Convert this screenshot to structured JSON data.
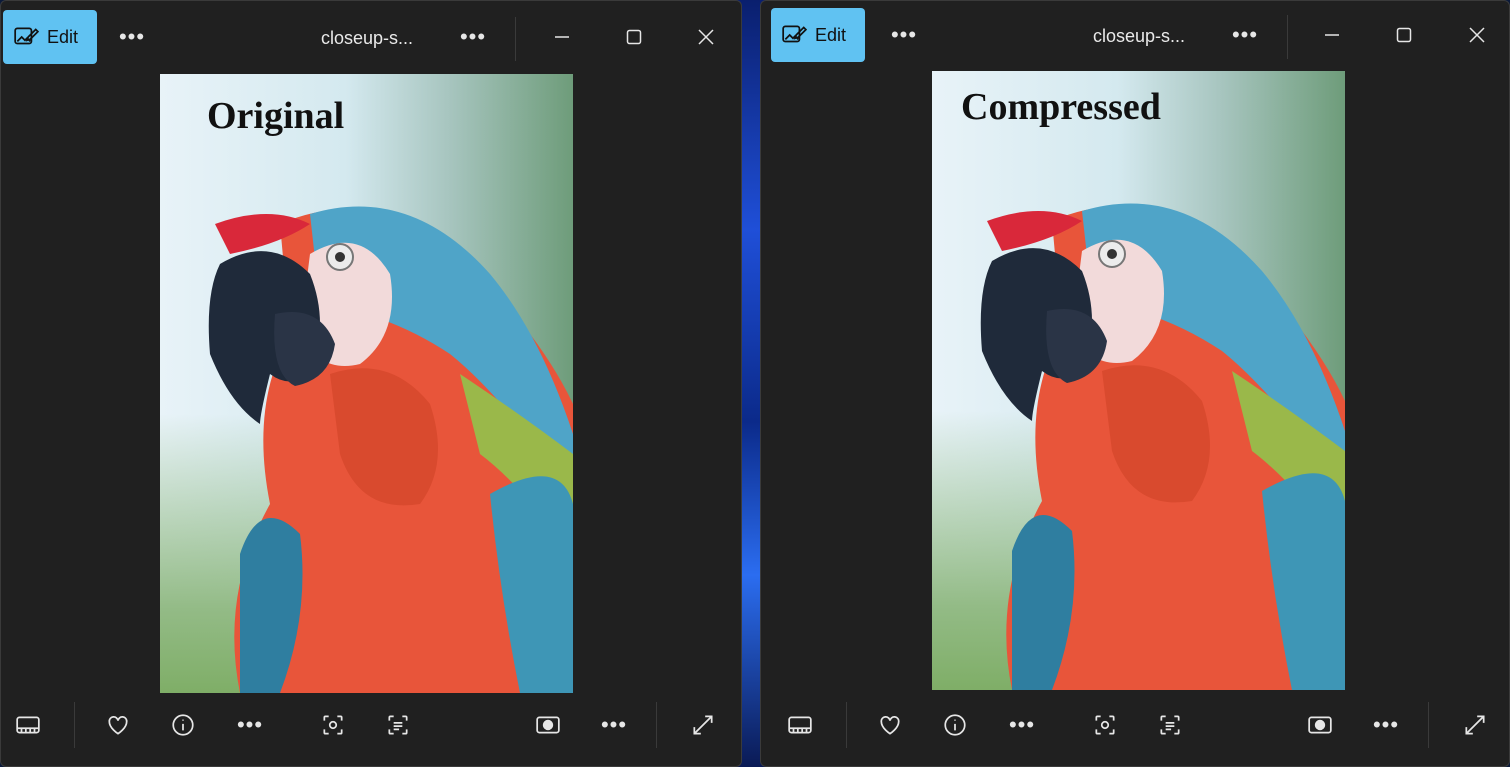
{
  "windows": [
    {
      "id": "left",
      "edit_label": "Edit",
      "file_name": "closeup-s...",
      "image_label": "Original"
    },
    {
      "id": "right",
      "edit_label": "Edit",
      "file_name": "closeup-s...",
      "image_label": "Compressed"
    }
  ],
  "icons": {
    "more": "•••",
    "minimize": "minimize-icon",
    "maximize": "maximize-icon",
    "close": "close-icon",
    "filmstrip": "filmstrip-icon",
    "favorite": "heart-icon",
    "info": "info-icon",
    "visual_search": "visual-search-icon",
    "text_detect": "text-detect-icon",
    "slideshow": "slideshow-icon",
    "fullscreen": "expand-icon"
  },
  "colors": {
    "accent": "#60c2f2",
    "window_bg": "#202020"
  }
}
